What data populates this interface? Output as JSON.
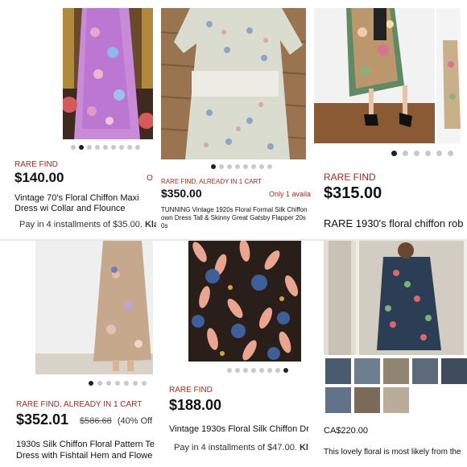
{
  "cards": [
    {
      "badge": "RARE FIND",
      "price": "$140.00",
      "title": "Vintage 70's Floral Chiffon Maxi Dress wi Collar and Flounce",
      "installments": "Pay in 4 installments of $35.00.",
      "brand": "Klarna",
      "corner": "O",
      "dots": 9
    },
    {
      "badge": "RARE FIND, ALREADY IN 1 CART",
      "price": "$350.00",
      "availability": "Only 1 availa",
      "title": "TUNNING Vintage 1920s Floral Formal Silk Chiffon own Dress Tall & Skinny Great Gatsby Flapper 20s 0s",
      "dots": 8
    },
    {
      "badge": "RARE FIND",
      "price": "$315.00",
      "title": "RARE 1930's floral chiffon rob",
      "dots": 6
    },
    {
      "badge": "RARE FIND, ALREADY IN 1 CART",
      "price": "$352.01",
      "original_price": "$586.68",
      "discount": "(40% Off",
      "title": "1930s Silk Chiffon Floral Pattern Te Dress with Fishtail Hem and Flowe",
      "dots": 7
    },
    {
      "badge": "RARE FIND",
      "price": "$188.00",
      "title": "Vintage 1930s Floral Silk Chiffon Dr",
      "installments": "Pay in 4 installments of $47.00.",
      "brand": "Kl",
      "dots": 8
    },
    {
      "price": "CA$220.00",
      "title": "This lovely floral is most likely from the",
      "thumbnails": 8
    }
  ],
  "colors": {
    "badge": "#a12c1f",
    "dot_active": "#222222",
    "dot_inactive": "#c9c9c9"
  }
}
